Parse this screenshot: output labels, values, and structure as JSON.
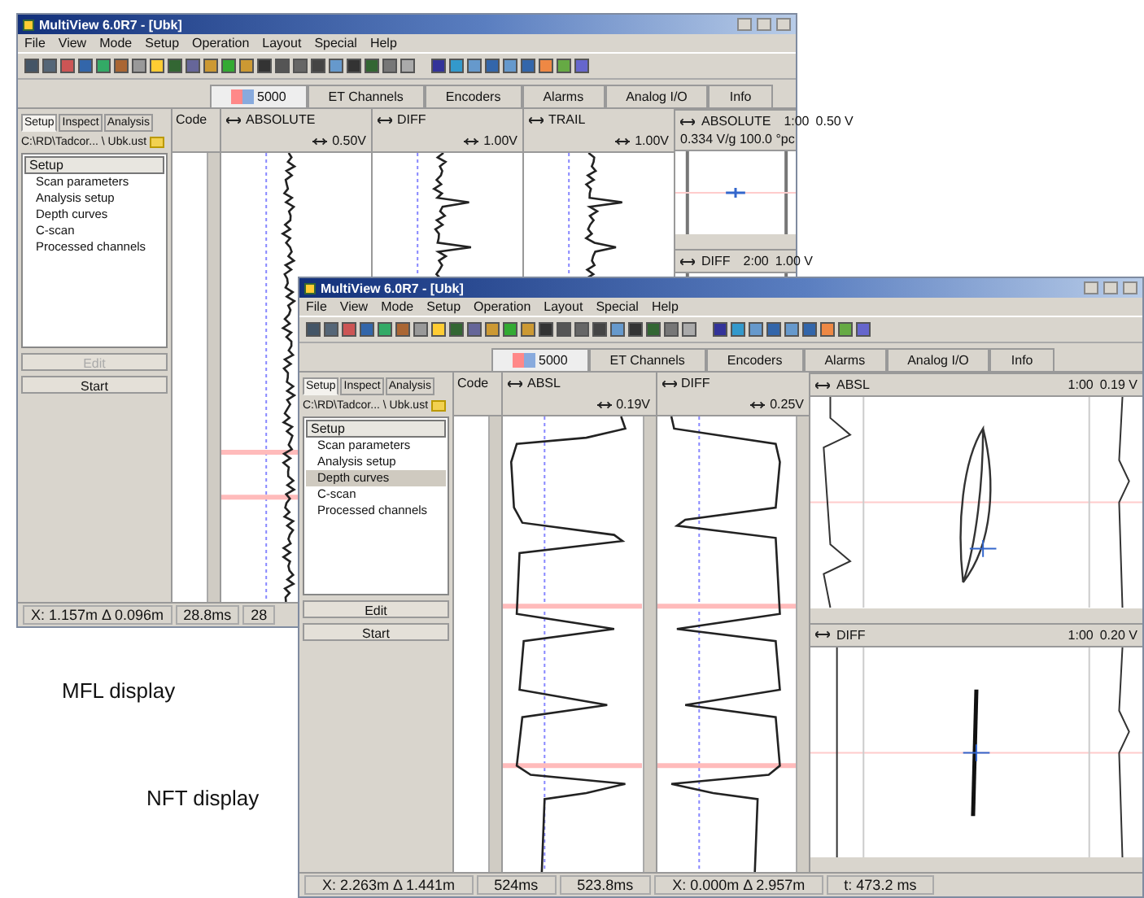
{
  "windows": [
    {
      "title": "MultiView 6.0R7 - [Ubk]",
      "menu": [
        "File",
        "View",
        "Mode",
        "Setup",
        "Operation",
        "Layout",
        "Special",
        "Help"
      ],
      "device_tabs": [
        {
          "label": "5000",
          "selected": true
        },
        {
          "label": "ET Channels",
          "selected": false
        },
        {
          "label": "Encoders",
          "selected": false
        },
        {
          "label": "Alarms",
          "selected": false
        },
        {
          "label": "Analog I/O",
          "selected": false
        },
        {
          "label": "Info",
          "selected": false
        }
      ],
      "panel_tabs": [
        {
          "label": "Setup",
          "selected": true
        },
        {
          "label": "Inspect",
          "selected": false
        },
        {
          "label": "Analysis",
          "selected": false
        }
      ],
      "file_path": "C:\\RD\\Tadcor... \\ Ubk.ust",
      "tree": {
        "label": "Setup",
        "children": [
          {
            "label": "Scan parameters",
            "selected": false
          },
          {
            "label": "Analysis setup",
            "selected": false
          },
          {
            "label": "Depth curves",
            "selected": false
          },
          {
            "label": "C-scan",
            "selected": false
          },
          {
            "label": "Processed channels",
            "selected": false
          }
        ]
      },
      "buttons": [
        {
          "label": "Edit",
          "disabled": true
        },
        {
          "label": "Start",
          "disabled": false
        }
      ],
      "code_column": "Code",
      "strips": [
        {
          "name": "ABSOLUTE",
          "scale": "0.50V"
        },
        {
          "name": "DIFF",
          "scale": "1.00V"
        },
        {
          "name": "TRAIL",
          "scale": "1.00V"
        }
      ],
      "lissajous": [
        {
          "name": "ABSOLUTE",
          "ratio": "1:00",
          "scale": "0.50 V",
          "detail": "0.334 V/g 100.0 °pc"
        },
        {
          "name": "DIFF",
          "ratio": "2:00",
          "scale": "1.00 V"
        }
      ],
      "status": [
        "X: 1.157m Δ 0.096m",
        "28.8ms",
        "28"
      ]
    },
    {
      "title": "MultiView 6.0R7 - [Ubk]",
      "menu": [
        "File",
        "View",
        "Mode",
        "Setup",
        "Operation",
        "Layout",
        "Special",
        "Help"
      ],
      "device_tabs": [
        {
          "label": "5000",
          "selected": true
        },
        {
          "label": "ET Channels",
          "selected": false
        },
        {
          "label": "Encoders",
          "selected": false
        },
        {
          "label": "Alarms",
          "selected": false
        },
        {
          "label": "Analog I/O",
          "selected": false
        },
        {
          "label": "Info",
          "selected": false
        }
      ],
      "panel_tabs": [
        {
          "label": "Setup",
          "selected": true
        },
        {
          "label": "Inspect",
          "selected": false
        },
        {
          "label": "Analysis",
          "selected": false
        }
      ],
      "file_path": "C:\\RD\\Tadcor... \\ Ubk.ust",
      "tree": {
        "label": "Setup",
        "children": [
          {
            "label": "Scan parameters",
            "selected": false
          },
          {
            "label": "Analysis setup",
            "selected": false
          },
          {
            "label": "Depth curves",
            "selected": true
          },
          {
            "label": "C-scan",
            "selected": false
          },
          {
            "label": "Processed channels",
            "selected": false
          }
        ]
      },
      "buttons": [
        {
          "label": "Edit",
          "disabled": false
        },
        {
          "label": "Start",
          "disabled": false
        }
      ],
      "code_column": "Code",
      "strips": [
        {
          "name": "ABSL",
          "scale": "0.19V"
        },
        {
          "name": "DIFF",
          "scale": "0.25V"
        }
      ],
      "lissajous": [
        {
          "name": "ABSL",
          "ratio": "1:00",
          "scale": "0.19 V"
        },
        {
          "name": "DIFF",
          "ratio": "1:00",
          "scale": "0.20 V"
        }
      ],
      "status": [
        "X: 2.263m Δ 1.441m",
        "524ms",
        "523.8ms",
        "X: 0.000m Δ 2.957m",
        "t: 473.2 ms"
      ]
    }
  ],
  "captions": [
    "MFL display",
    "NFT display"
  ]
}
